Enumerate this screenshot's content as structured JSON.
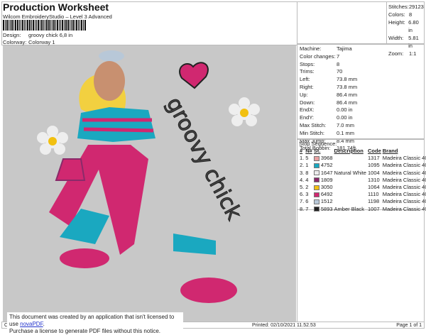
{
  "header": {
    "title": "Production Worksheet",
    "subtitle": "Wilcom EmbroideryStudio – Level 3 Advanced",
    "design_label": "Design:",
    "design": "groovy chick 6,8 in",
    "colorway_label": "Colorway:",
    "colorway": "Colorway 1"
  },
  "summary": [
    {
      "k": "Stitches:",
      "v": "29123"
    },
    {
      "k": "Colors:",
      "v": "8"
    },
    {
      "k": "Height:",
      "v": "6.80 in"
    },
    {
      "k": "Width:",
      "v": "5.81 in"
    },
    {
      "k": "Zoom:",
      "v": "1:1"
    }
  ],
  "machine": [
    {
      "k": "Machine:",
      "v": "Tajima"
    },
    {
      "k": "Color changes:",
      "v": "7"
    },
    {
      "k": "Stops:",
      "v": "8"
    },
    {
      "k": "Trims:",
      "v": "70"
    },
    {
      "k": "Left:",
      "v": "73.8 mm"
    },
    {
      "k": "Right:",
      "v": "73.8 mm"
    },
    {
      "k": "Up:",
      "v": "86.4 mm"
    },
    {
      "k": "Down:",
      "v": "86.4 mm"
    },
    {
      "k": "EndX:",
      "v": "0.00 in"
    },
    {
      "k": "EndY:",
      "v": "0.00 in"
    },
    {
      "k": "Max Stitch:",
      "v": "7.0 mm"
    },
    {
      "k": "Min Stitch:",
      "v": "0.1 mm"
    },
    {
      "k": "Max Jump:",
      "v": "8.4 mm"
    },
    {
      "k": "Total Bobbin:",
      "v": "181.74ft"
    }
  ],
  "stop_sequence": {
    "title": "Stop Sequence:",
    "headers": [
      "#",
      "N#",
      "St.",
      "Description",
      "Code",
      "Brand"
    ],
    "rows": [
      {
        "n": "1.",
        "needle": "5",
        "color": "#e8a0a0",
        "st": "3968",
        "desc": "",
        "code": "1317",
        "brand": "Madeira Classic 40"
      },
      {
        "n": "2.",
        "needle": "1",
        "color": "#1aa8c0",
        "st": "4752",
        "desc": "",
        "code": "1095",
        "brand": "Madeira Classic 40"
      },
      {
        "n": "3.",
        "needle": "8",
        "color": "#ececec",
        "st": "1647",
        "desc": "Natural White",
        "code": "1004",
        "brand": "Madeira Classic 40"
      },
      {
        "n": "4.",
        "needle": "4",
        "color": "#8a2a6a",
        "st": "1809",
        "desc": "",
        "code": "1310",
        "brand": "Madeira Classic 40"
      },
      {
        "n": "5.",
        "needle": "2",
        "color": "#f2c010",
        "st": "3050",
        "desc": "",
        "code": "1064",
        "brand": "Madeira Classic 40"
      },
      {
        "n": "6.",
        "needle": "3",
        "color": "#d02870",
        "st": "6492",
        "desc": "",
        "code": "1110",
        "brand": "Madeira Classic 40"
      },
      {
        "n": "7.",
        "needle": "6",
        "color": "#b8c8d8",
        "st": "1512",
        "desc": "",
        "code": "1198",
        "brand": "Madeira Classic 40"
      },
      {
        "n": "8.",
        "needle": "7",
        "color": "#222222",
        "st": "5893",
        "desc": "Amber Black",
        "code": "1007",
        "brand": "Madeira Classic 40"
      }
    ]
  },
  "design_text": "groovy chick",
  "footer": {
    "left": "Cr",
    "printed": "Printed: 02/10/2021 11.52.53",
    "page": "Page 1 of 1"
  },
  "notice": {
    "line1": "This document was created by an application that isn't licensed to use ",
    "link": "novaPDF",
    "line1_end": ".",
    "line2": "Purchase a license to generate PDF files without this notice."
  }
}
